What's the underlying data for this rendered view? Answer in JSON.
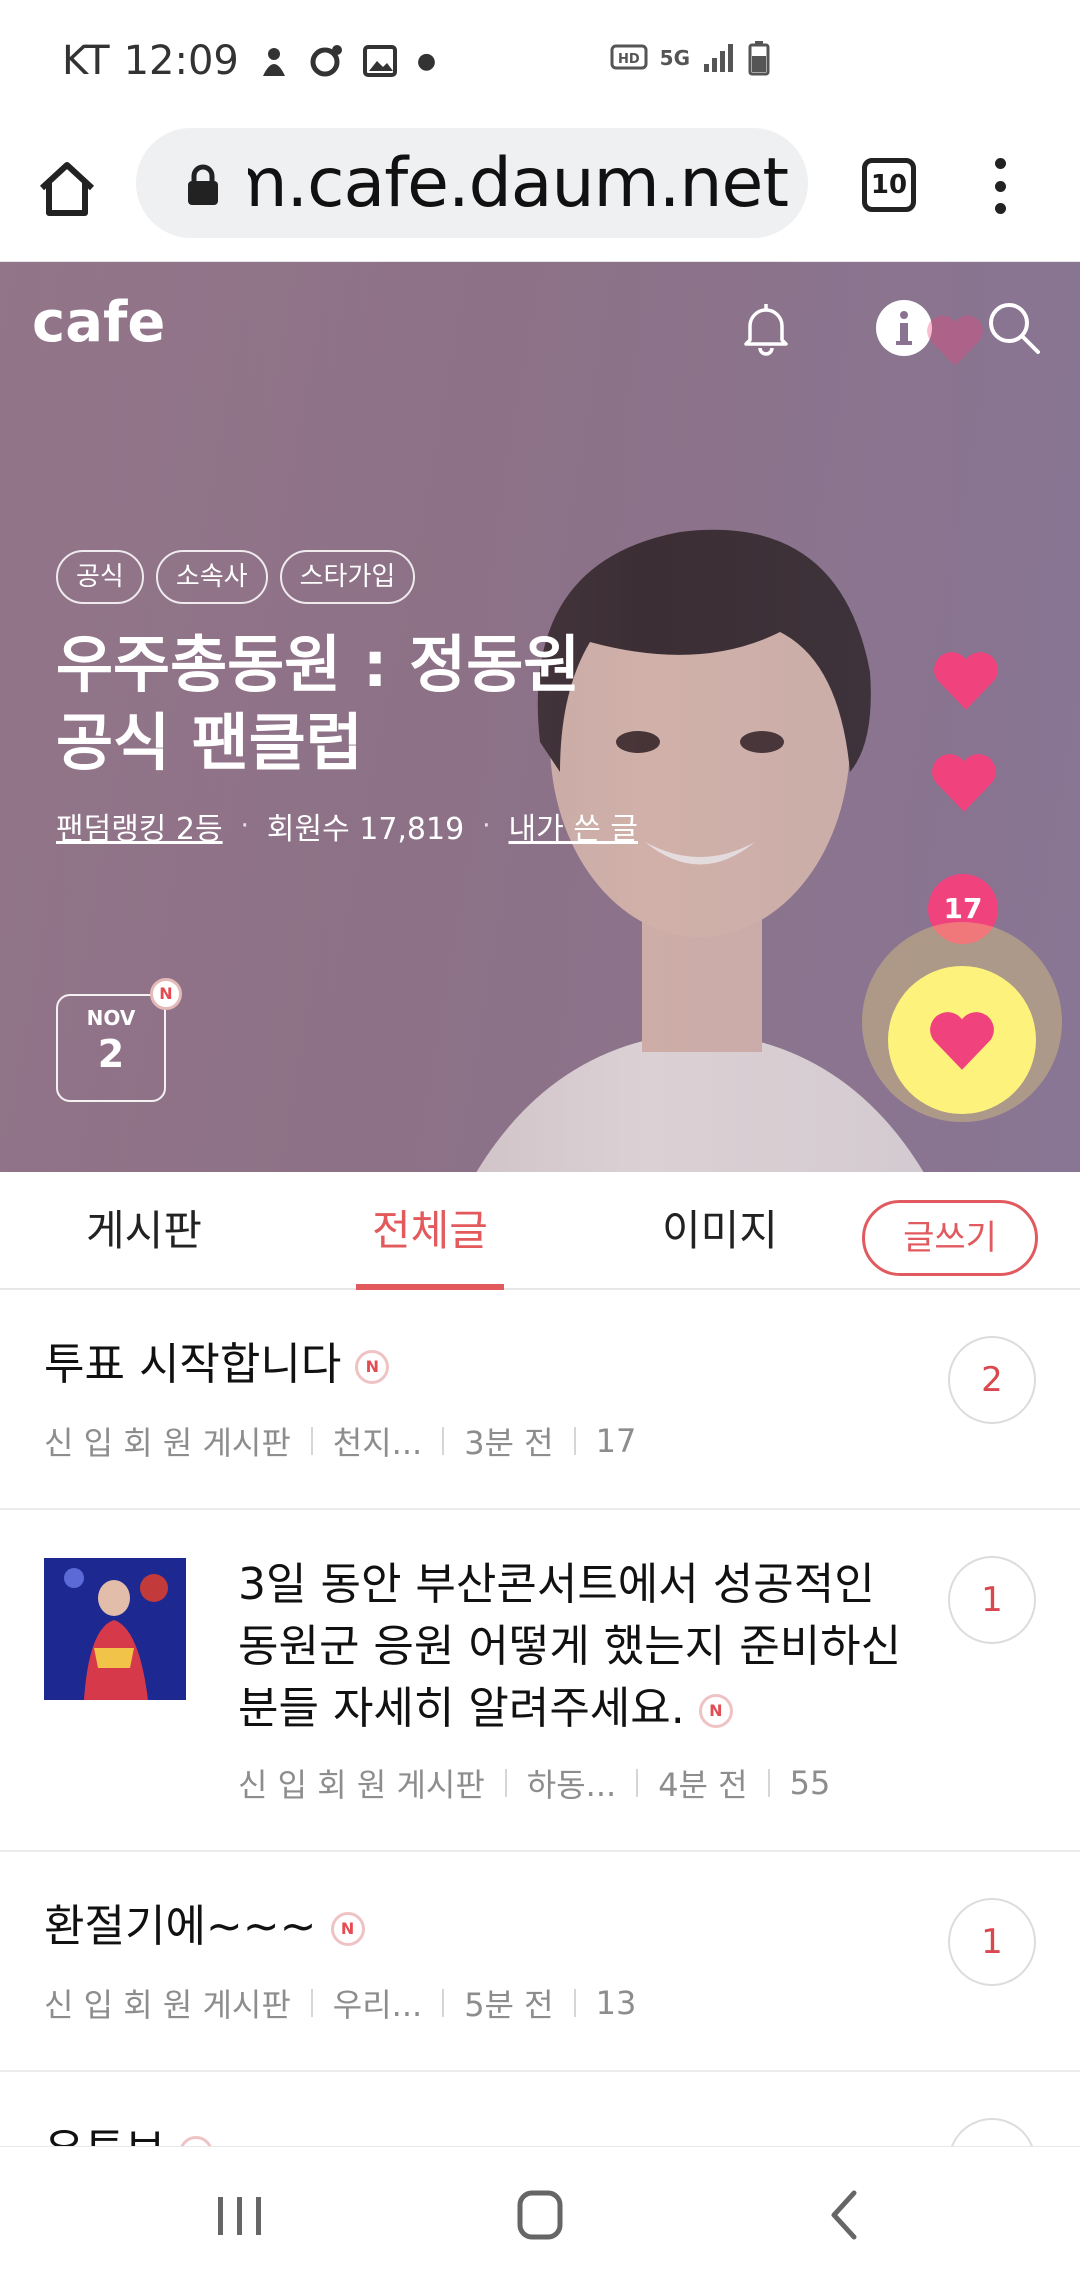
{
  "status_bar": {
    "carrier": "KT",
    "time": "12:09",
    "network": "5G"
  },
  "browser": {
    "url": "m.cafe.daum.net",
    "tab_count": "10"
  },
  "hero": {
    "logo": "cafe",
    "tags": [
      "공식",
      "소속사",
      "스타가입"
    ],
    "title_line1": "우주총동원 : 정동원",
    "title_line2": "공식 팬클럽",
    "ranking": "팬덤랭킹 2등",
    "members": "회원수 17,819",
    "my_posts": "내가 쓴 글",
    "date_month": "NOV",
    "date_day": "2",
    "new_badge": "N",
    "like_count": "17",
    "colors": {
      "like_button": "#fdf27c",
      "heart": "#f0427d",
      "accent": "#e35a5d"
    }
  },
  "tabs": {
    "board": "게시판",
    "all_posts": "전체글",
    "images": "이미지",
    "write": "글쓰기"
  },
  "posts": [
    {
      "title": "투표 시작합니다",
      "board": "신 입 회 원 게시판",
      "author": "천지...",
      "time": "3분 전",
      "views": "17",
      "comments": "2",
      "badge": "N"
    },
    {
      "title_line1": "3일 동안 부산콘서트에서 성공적인",
      "title_line2": "동원군 응원 어떻게 했는지 준비하신",
      "title_line3": "분들 자세히 알려주세요.",
      "board": "신 입 회 원 게시판",
      "author": "하동...",
      "time": "4분 전",
      "views": "55",
      "comments": "1",
      "badge": "N"
    },
    {
      "title": "환절기에~~~",
      "board": "신 입 회 원 게시판",
      "author": "우리...",
      "time": "5분 전",
      "views": "13",
      "comments": "1",
      "badge": "N"
    },
    {
      "title": "유튜브",
      "badge": "N"
    }
  ]
}
